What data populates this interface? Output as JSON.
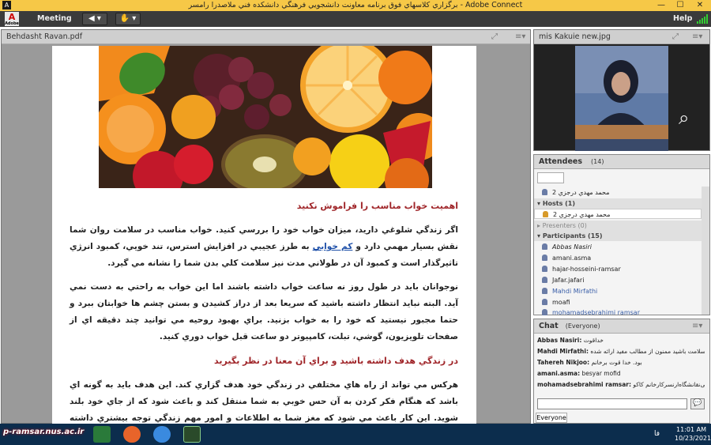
{
  "window": {
    "title": "برگزاري كلاسهاي فوق برنامه معاونت دانشجويي فرهنگي دانشكده فني ملاصدرا رامسر - Adobe Connect",
    "app_icon": "adobe-connect-icon",
    "minimize": "—",
    "maximize": "☐",
    "close": "✕"
  },
  "menu": {
    "logo_text": "A",
    "logo_sub": "Adobe",
    "meeting": "Meeting",
    "help": "Help",
    "speaker_icon": "speaker-icon",
    "mic_icon": "hand-raise-icon",
    "arrow": "▾"
  },
  "doc_pod": {
    "title": "Behdasht Ravan.pdf",
    "heading1": "اهميت خواب مناسب را فراموش نكنيد",
    "para1_a": "اگر زندگي شلوغي داريد، ميزان خواب خود را بررسي كنيد. خواب مناسب در سلامت روان شما نقش بسيار مهمي دارد و ",
    "para1_link": "كم خوابي",
    "para1_b": " به طرز عجيبي در افزايش استرس، تند خويي، كمبود انرژي تاثيرگذار است و كمبود آن در طولاني مدت نيز سلامت كلي بدن شما را نشانه مي گيرد.",
    "para2": "نوجوانان بايد در طول روز نه ساعت خواب داشته باشند اما اين خواب به راحتي به دست نمي آيد. البته نبايد انتظار داشته باشيد كه سريعا بعد از دراز كشيدن و بستن چشم ها خوابتان ببرد و حتما مجبور نيستيد كه خود را به خواب بزنيد. براي بهبود روحيه مي توانيد چند دقيقه اي از صفحات تلويزيون، گوشي، تبلت، كامپيوتر دو ساعت قبل خواب دوري كنيد.",
    "heading2": "در زندگي هدف داشته باشيد و براي آن معنا در نظر بگيريد",
    "para3": "هركس مي تواند از راه هاي مختلفي در زندگي خود هدف گزاري كند. اين هدف بايد به گونه اي باشد كه هنگام فكر كردن به آن حس خوبي به شما منتقل كند و باعث شود كه از جاي خود بلند شويد. اين كار باعث مي شود كه مغز شما به اطلاعات و امور مهم زندگي توجه بيشتري داشته باشد و انگيزه بيشتري براي زندگي پيدا كنيد."
  },
  "cam_pod": {
    "title": "mis Kakuie new.jpg",
    "zoom_icon": "magnifier-icon"
  },
  "attendees": {
    "title": "Attendees",
    "count": "(14)",
    "me": "محمد مهدي درجزي 2",
    "hosts_label": "Hosts (1)",
    "host_name": "محمد مهدي درجزي 2",
    "presenters_label": "Presenters (0)",
    "participants_label": "Participants (15)",
    "participants": [
      "Abbas Nasiri",
      "amani.asma",
      "hajar-hosseini-ramsar",
      "Jafar.jafari",
      "Mahdi Mirfathi",
      "moafi",
      "mohamadsebrahimi ramsar"
    ]
  },
  "chat": {
    "title": "Chat",
    "scope": "(Everyone)",
    "messages": [
      {
        "name": "Abbas Nasiri:",
        "text": "خداقوت"
      },
      {
        "name": "Mahdi Mirfathi:",
        "text": "سلامت باشید  ممنون از مطالب مفید ارائه شده"
      },
      {
        "name": "Tahereh Nikjoo:",
        "text": "بود. خدا قوت برخانم"
      },
      {
        "name": "amani.asma:",
        "text": "besyar mofid"
      },
      {
        "name": "mohamadsebrahimi ramsar:",
        "text": "دوسفته نداش بی‌نقانشگاه‌ارنسرکارخانم کاکو"
      }
    ],
    "tab_everyone": "Everyone",
    "send_icon": "send-bubble-icon"
  },
  "taskbar": {
    "watermark": "p-ramsar.nus.ac.ir",
    "time": "11:01 AM",
    "date": "10/23/2021",
    "lang": "فا"
  }
}
